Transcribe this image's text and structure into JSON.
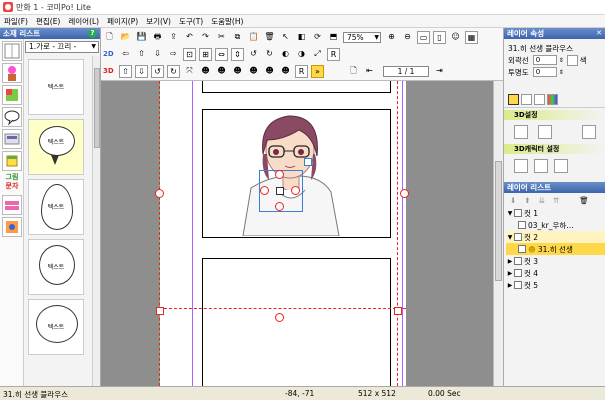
{
  "window": {
    "title": "만화 1 - 코미Po! Lite"
  },
  "menu": [
    "파일(F)",
    "편집(E)",
    "레이어(L)",
    "페이지(P)",
    "보기(V)",
    "도구(T)",
    "도움말(H)"
  ],
  "material_list": {
    "header": "소재 리스트",
    "help": "?",
    "category_text": [
      "그림",
      "문자"
    ],
    "select_value": "1.가로 - 끄리 -",
    "thumbnails": [
      {
        "label": "텍스트",
        "shape": "square"
      },
      {
        "label": "텍스트",
        "shape": "speech"
      },
      {
        "label": "텍스트",
        "shape": "round"
      },
      {
        "label": "텍스트",
        "shape": "round"
      },
      {
        "label": "텍스트",
        "shape": "round"
      }
    ]
  },
  "toolbar": {
    "mode_2d": "2D",
    "mode_3d": "3D",
    "zoom": "75%",
    "page": "1 / 1"
  },
  "layer_props": {
    "header": "레이어 속성",
    "name": "31.히 선생 블라우스",
    "outline_label": "외곽선",
    "outline_value": "0",
    "color_label": "색",
    "opacity_label": "투명도",
    "opacity_value": "0",
    "section_3d": "3D설정",
    "section_3d_char": "3D캐릭터 설정"
  },
  "layer_list": {
    "header": "레이어 리스트",
    "items": [
      {
        "name": "컷 1",
        "indent": 0,
        "type": "cut"
      },
      {
        "name": "03_kr_우하…",
        "indent": 1,
        "type": "image"
      },
      {
        "name": "컷 2",
        "indent": 0,
        "type": "cut"
      },
      {
        "name": "31.히 선생",
        "indent": 1,
        "type": "char",
        "active": true
      },
      {
        "name": "컷 3",
        "indent": 0,
        "type": "cut"
      },
      {
        "name": "컷 4",
        "indent": 0,
        "type": "cut"
      },
      {
        "name": "컷 5",
        "indent": 0,
        "type": "cut"
      }
    ]
  },
  "status": {
    "layer": "31.히 선생 블라우스",
    "coords": "-84, -71",
    "size": "512 x 512",
    "time": "0.00 Sec"
  },
  "colors": {
    "accent": "#3d64ad",
    "handle": "#e22222",
    "active": "#ffd84a"
  }
}
